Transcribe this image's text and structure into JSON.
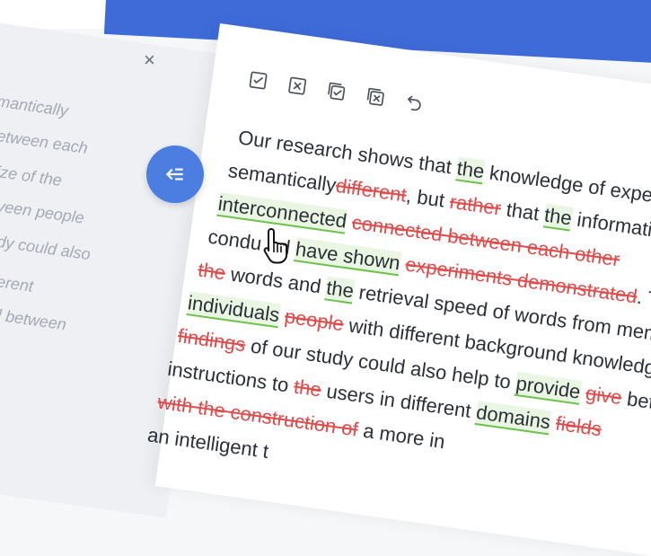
{
  "colors": {
    "accent": "#3f6bd9",
    "insert": "#6cc24a",
    "delete": "#e04b4b",
    "fab": "#4b7ee0"
  },
  "left_panel": {
    "close_icon": "close-icon",
    "lines": [
      "mantically",
      "etween each",
      "ize of the",
      "veen people",
      "dy could also",
      "erent",
      "] between"
    ]
  },
  "toolbar": {
    "icons": [
      "accept-icon",
      "reject-icon",
      "accept-all-icon",
      "reject-all-icon",
      "undo-icon"
    ]
  },
  "fab": {
    "icon": "collapse-arrow-icon"
  },
  "text": {
    "l1": {
      "a": "Our research shows that",
      "b": "the",
      "c": "knowledge of experts"
    },
    "l2": {
      "a": "semantically",
      "b": "different",
      "c": ", but",
      "d": "rather",
      "e": "that",
      "f": "the",
      "g": "informatio"
    },
    "l3": {
      "a": "interconnected",
      "b": "connected between each other"
    },
    "l4": {
      "a": "condu",
      "b": "d",
      "c": "have shown",
      "d": "experiments demonstrated",
      "e": ". The"
    },
    "l5": {
      "a": "the",
      "b": "words and",
      "c": "the",
      "d": "retrieval speed of words from memo"
    },
    "l6": {
      "a": "individuals",
      "b": "people",
      "c": "with different background knowledge"
    },
    "l7": {
      "a": "findings",
      "b": "of our study could also help to",
      "c": "provide",
      "d": "give",
      "e": "bett"
    },
    "l8": {
      "a": "instructions to",
      "b": "the",
      "c": "users in different",
      "d": "domains",
      "e": "fields"
    },
    "l9": {
      "a": "with the construction of",
      "b": "a more in"
    },
    "l10": {
      "a": "an intelligent t"
    }
  }
}
